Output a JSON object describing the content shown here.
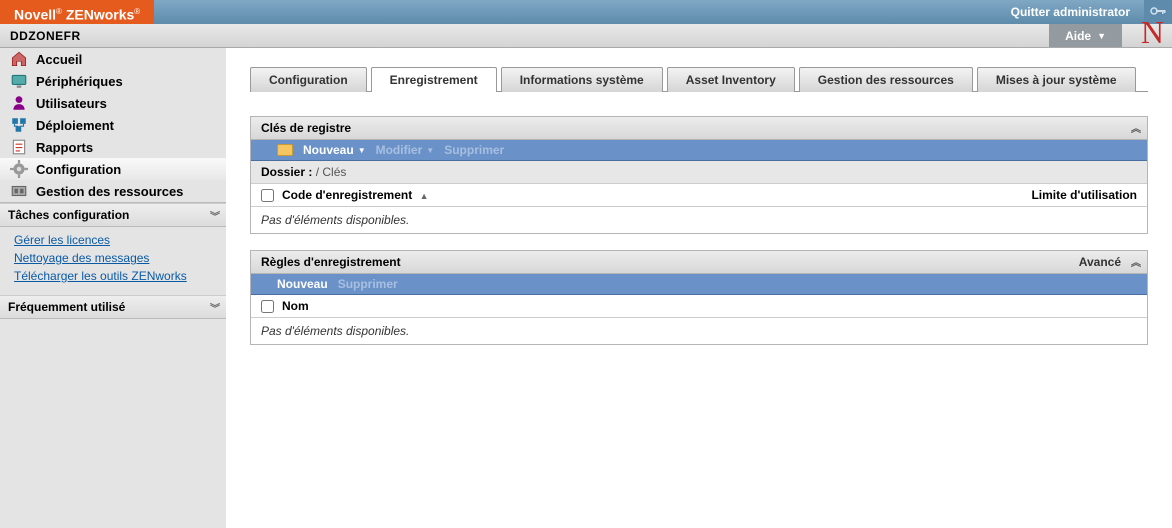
{
  "header": {
    "brand_main": "Novell",
    "brand_sub": "ZENworks",
    "logout": "Quitter administrator",
    "zone": "DDZONEFR",
    "help": "Aide"
  },
  "sidebar": {
    "items": [
      {
        "label": "Accueil",
        "icon": "home-icon"
      },
      {
        "label": "Périphériques",
        "icon": "monitor-icon"
      },
      {
        "label": "Utilisateurs",
        "icon": "user-icon"
      },
      {
        "label": "Déploiement",
        "icon": "deploy-icon"
      },
      {
        "label": "Rapports",
        "icon": "reports-icon"
      },
      {
        "label": "Configuration",
        "icon": "gear-icon"
      },
      {
        "label": "Gestion des ressources",
        "icon": "resources-icon"
      }
    ],
    "tasks_header": "Tâches configuration",
    "tasks": [
      "Gérer les licences",
      "Nettoyage des messages",
      "Télécharger les outils ZENworks"
    ],
    "frequent_header": "Fréquemment utilisé"
  },
  "tabs": [
    "Configuration",
    "Enregistrement",
    "Informations système",
    "Asset Inventory",
    "Gestion des ressources",
    "Mises à jour système"
  ],
  "panel_keys": {
    "title": "Clés de registre",
    "actions": {
      "new": "Nouveau",
      "edit": "Modifier",
      "delete": "Supprimer"
    },
    "path_label": "Dossier :",
    "path_value": "/ Clés",
    "col1": "Code d'enregistrement",
    "col2": "Limite d'utilisation",
    "empty": "Pas d'éléments disponibles."
  },
  "panel_rules": {
    "title": "Règles d'enregistrement",
    "advanced": "Avancé",
    "actions": {
      "new": "Nouveau",
      "delete": "Supprimer"
    },
    "col1": "Nom",
    "empty": "Pas d'éléments disponibles."
  }
}
